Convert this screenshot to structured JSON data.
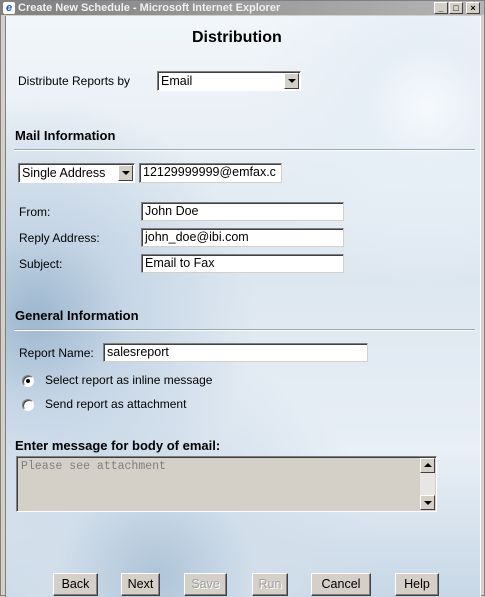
{
  "window": {
    "title": "Create New Schedule - Microsoft Internet Explorer",
    "controls": {
      "minimize": "_",
      "maximize": "□",
      "close": "×"
    }
  },
  "page": {
    "heading": "Distribution",
    "distribute_by": {
      "label": "Distribute Reports by",
      "selected": "Email"
    },
    "mail_info": {
      "heading": "Mail Information",
      "address_type": "Single Address",
      "address_value": "12129999999@emfax.c",
      "from": {
        "label": "From:",
        "value": "John Doe"
      },
      "reply": {
        "label": "Reply Address:",
        "value": "john_doe@ibi.com"
      },
      "subject": {
        "label": "Subject:",
        "value": "Email to Fax"
      }
    },
    "general_info": {
      "heading": "General Information",
      "report_name": {
        "label": "Report Name:",
        "value": "salesreport"
      },
      "option_inline": {
        "label": "Select report as inline message",
        "checked": true
      },
      "option_attachment": {
        "label": "Send report as attachment",
        "checked": false
      }
    },
    "message": {
      "label": "Enter message for body of email:",
      "placeholder": "Please see attachment"
    },
    "buttons": {
      "back": "Back",
      "next": "Next",
      "save": "Save",
      "run": "Run",
      "cancel": "Cancel",
      "help": "Help"
    }
  },
  "icons": {
    "ie": "ie-logo-icon",
    "dropdown": "chevron-down-icon",
    "scroll_up": "arrow-up-icon",
    "scroll_down": "arrow-down-icon"
  },
  "colors": {
    "titlebar_inactive": "#808080",
    "window_chrome": "#d4d0c8",
    "background_tint": "#dde7f0"
  }
}
